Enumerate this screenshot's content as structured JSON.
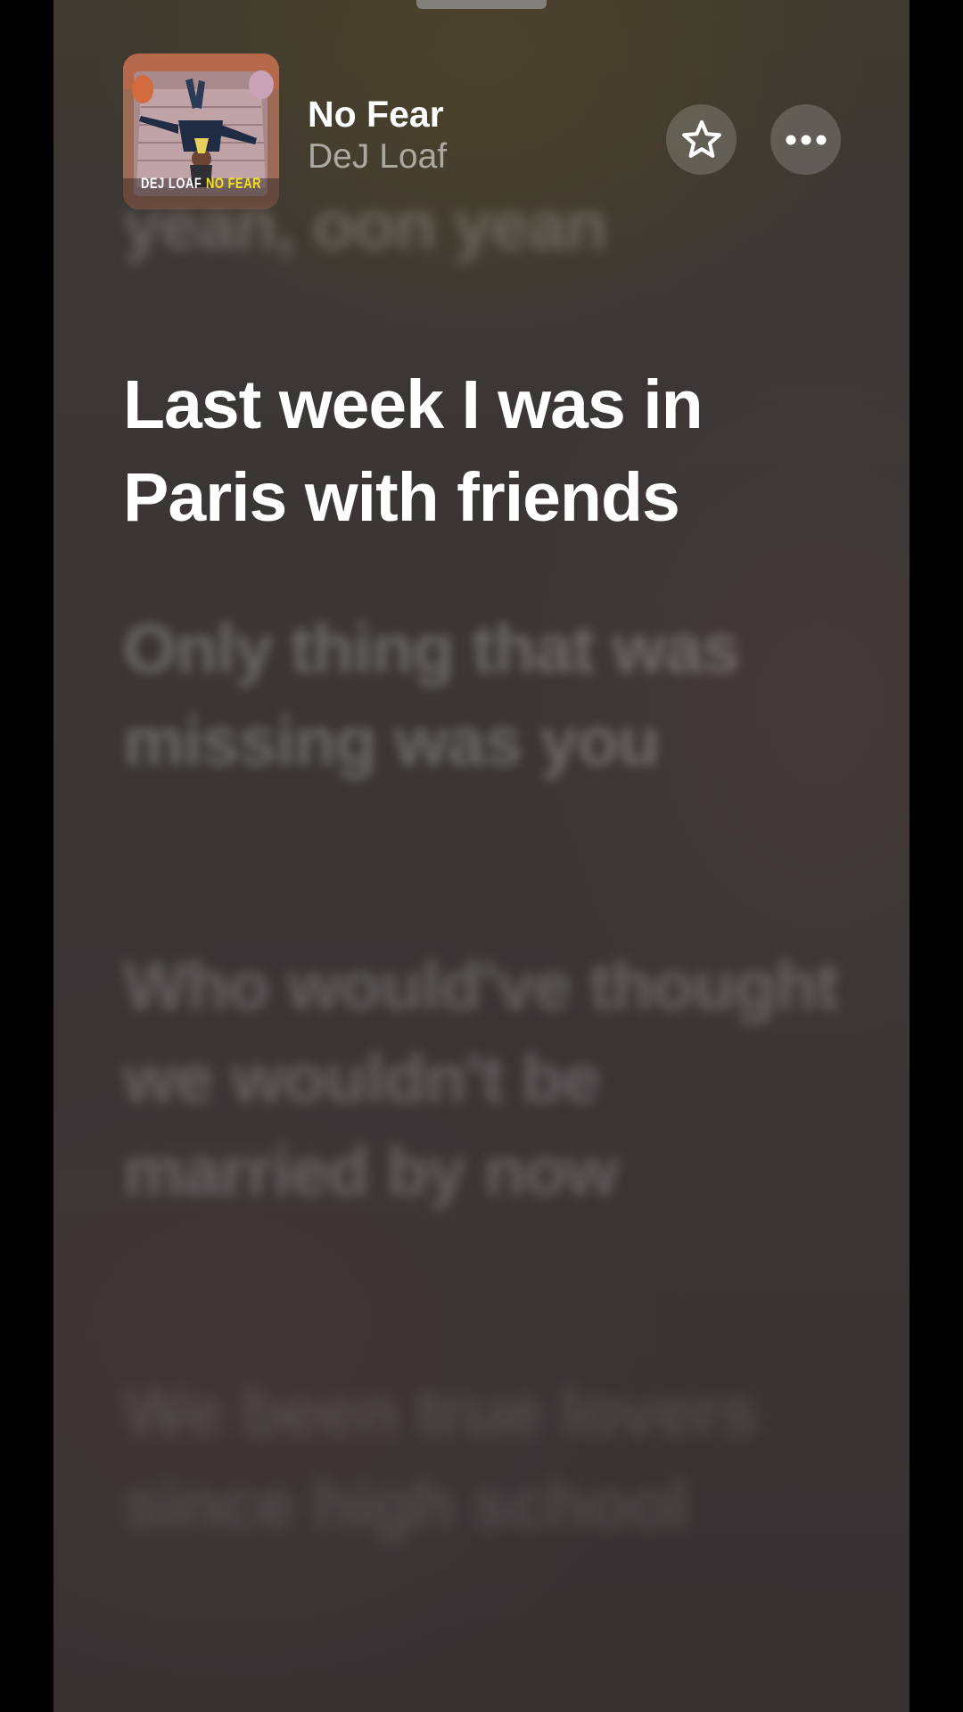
{
  "now_playing": {
    "title": "No Fear",
    "artist": "DeJ Loaf",
    "artwork": {
      "artist_text": "DEJ LOAF",
      "title_text": "NO FEAR"
    }
  },
  "actions": {
    "favorite_icon": "star-outline-icon",
    "more_icon": "ellipsis-icon"
  },
  "lyrics": {
    "previous": "yeah, ooh yeah",
    "current": "Last week I was in Paris with friends",
    "next": [
      "Only thing that was missing was you",
      "Who would've thought we wouldn't be married by now",
      "We been true lovers since high school"
    ]
  },
  "colors": {
    "background": "#3a3535",
    "active_lyric": "#ffffff",
    "artwork_title_accent": "#f2e21a"
  }
}
